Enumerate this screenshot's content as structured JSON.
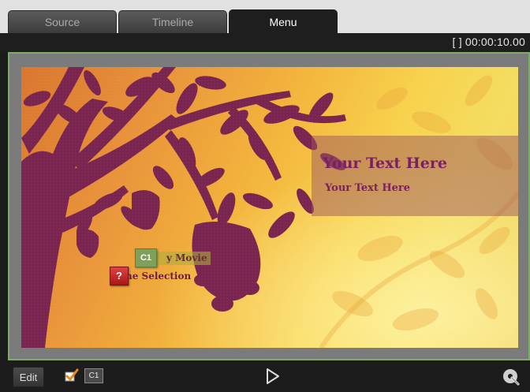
{
  "tabs": [
    {
      "label": "Source",
      "active": false
    },
    {
      "label": "Timeline",
      "active": false
    },
    {
      "label": "Menu",
      "active": true
    }
  ],
  "header": {
    "brackets": "[ ]",
    "timecode": "00:00:10.00"
  },
  "preview": {
    "title_text": "Your Text Here",
    "subtitle_text": "Your Text Here",
    "button_play": "y Movie",
    "button_scene": "ne Selection",
    "chapter_badge": "C1",
    "unlinked_badge": "?"
  },
  "toolbar": {
    "edit_label": "Edit",
    "chip_label": "C1",
    "icons": [
      "checkmark-icon",
      "play-icon",
      "disc-burn-icon"
    ]
  },
  "colors": {
    "accent_frame": "#7eab6a",
    "menu_text": "#7b1f63",
    "chapter_marker": "#7fa05a",
    "unlinked_marker": "#c82828"
  }
}
